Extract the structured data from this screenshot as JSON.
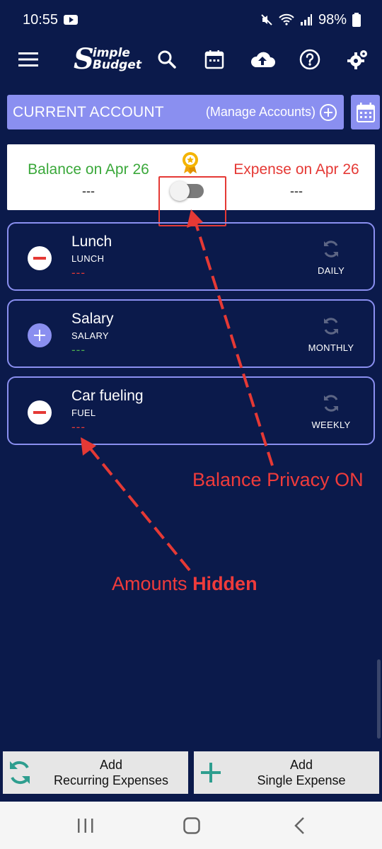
{
  "status": {
    "time": "10:55",
    "battery": "98%"
  },
  "app": {
    "logo_big": "S",
    "logo_word1": "imple",
    "logo_word2": "Budget"
  },
  "account": {
    "name": "CURRENT ACCOUNT",
    "manage_label": "(Manage Accounts)"
  },
  "summary": {
    "balance_label": "Balance on Apr 26",
    "balance_value": "---",
    "expense_label": "Expense on Apr 26",
    "expense_value": "---",
    "privacy_toggle_on": false
  },
  "items": [
    {
      "title": "Lunch",
      "category": "LUNCH",
      "amount": "---",
      "type": "expense",
      "repeat": "DAILY"
    },
    {
      "title": "Salary",
      "category": "SALARY",
      "amount": "---",
      "type": "income",
      "repeat": "MONTHLY"
    },
    {
      "title": "Car fueling",
      "category": "FUEL",
      "amount": "---",
      "type": "expense",
      "repeat": "WEEKLY"
    }
  ],
  "annotations": {
    "privacy": "Balance Privacy ON",
    "hidden_prefix": "Amounts ",
    "hidden_bold": "Hidden"
  },
  "buttons": {
    "recurring_line1": "Add",
    "recurring_line2": "Recurring Expenses",
    "single_line1": "Add",
    "single_line2": "Single Expense"
  },
  "colors": {
    "background": "#0b1a4b",
    "accent": "#8a8ff0",
    "income": "#3aa83a",
    "expense": "#e53935",
    "add_icon": "#2e9e8f"
  }
}
